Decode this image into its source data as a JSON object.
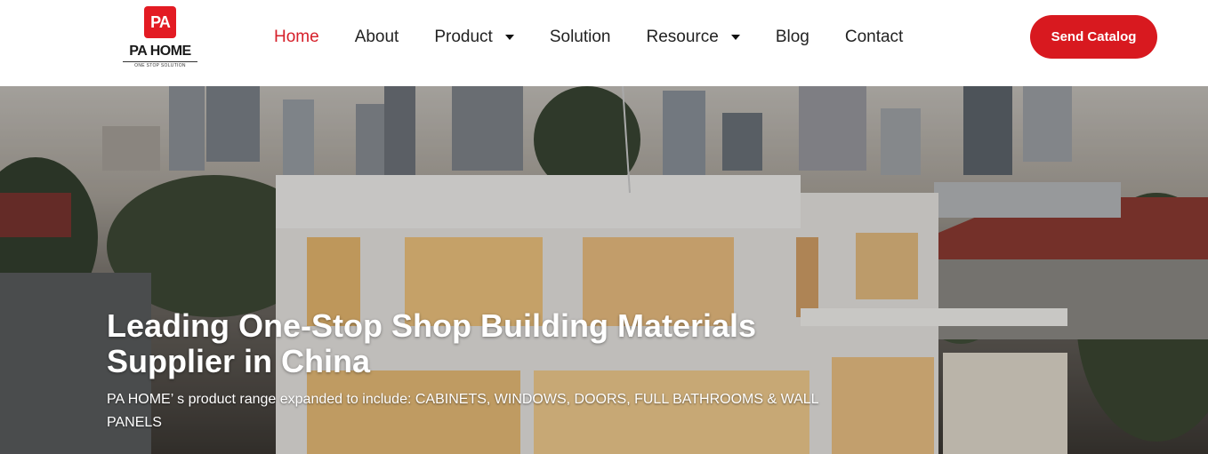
{
  "logo": {
    "badge": "PA",
    "name": "PA HOME",
    "tagline": "ONE STOP SOLUTION"
  },
  "nav": {
    "items": [
      {
        "label": "Home",
        "active": true
      },
      {
        "label": "About"
      },
      {
        "label": "Product",
        "dropdown": true
      },
      {
        "label": "Solution"
      },
      {
        "label": "Resource",
        "dropdown": true
      },
      {
        "label": "Blog"
      },
      {
        "label": "Contact"
      }
    ]
  },
  "cta": {
    "label": "Send Catalog"
  },
  "hero": {
    "title": "Leading One-Stop Shop Building Materials Supplier in China",
    "subtitle": "PA HOME’ s product range expanded to include: CABINETS, WINDOWS, DOORS, FULL BATHROOMS & WALL PANELS"
  },
  "colors": {
    "accent": "#d8191f",
    "active_nav": "#d6202a"
  }
}
